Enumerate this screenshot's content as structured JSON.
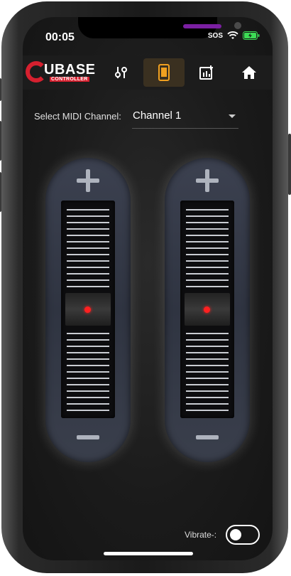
{
  "status": {
    "time": "00:05",
    "sos": "SOS"
  },
  "app": {
    "logo_text": "UBASE",
    "logo_subtext": "CONTROLLER"
  },
  "tabs": [
    {
      "icon": "sliders-icon",
      "active": false
    },
    {
      "icon": "phone-icon",
      "active": true
    },
    {
      "icon": "equalizer-icon",
      "active": false
    },
    {
      "icon": "home-icon",
      "active": false
    }
  ],
  "midi": {
    "label": "Select MIDI Channel:",
    "selected": "Channel 1"
  },
  "faders": [
    {
      "id": "fader-1",
      "level": 0.5
    },
    {
      "id": "fader-2",
      "level": 0.5
    }
  ],
  "vibrate": {
    "label": "Vibrate-:",
    "enabled": false
  },
  "colors": {
    "accent": "#d6202f",
    "active_tab": "#f0a020",
    "indicator": "#ff2020"
  }
}
